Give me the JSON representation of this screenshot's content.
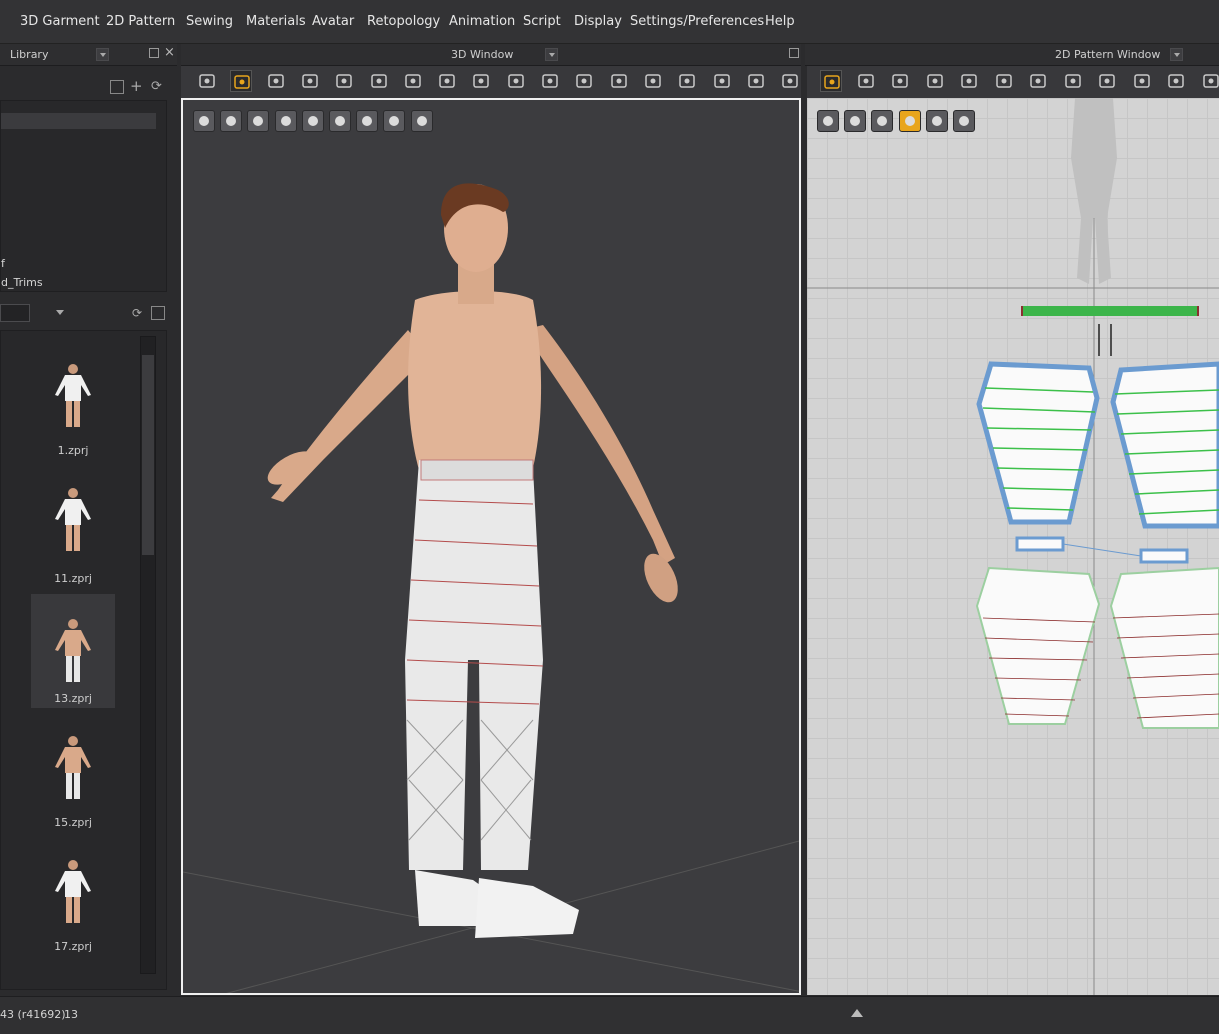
{
  "menu": [
    "3D Garment",
    "2D Pattern",
    "Sewing",
    "Materials",
    "Avatar",
    "Retopology",
    "Animation",
    "Script",
    "Display",
    "Settings/Preferences",
    "Help"
  ],
  "panels": {
    "library_title": "Library",
    "window3d_title": "3D Window",
    "pattern2d_title": "2D Pattern Window"
  },
  "library": {
    "tree_partial_1": "f",
    "tree_partial_2": "d_Trims",
    "items": [
      {
        "label": "1.zprj",
        "selected": false
      },
      {
        "label": "11.zprj",
        "selected": false
      },
      {
        "label": "13.zprj",
        "selected": true
      },
      {
        "label": "15.zprj",
        "selected": false
      },
      {
        "label": "17.zprj",
        "selected": false
      }
    ]
  },
  "status": {
    "version": "43 (r41692)",
    "count": "13"
  },
  "icons": {
    "toolbar3d": [
      "select-mesh-icon",
      "move-icon",
      "edit-pattern-icon",
      "fold-icon",
      "pin-icon",
      "segment-icon",
      "arrange-icon",
      "tuck-icon",
      "point-icon",
      "anchor-icon",
      "mesh-icon",
      "sewing-icon",
      "tape-icon",
      "button-icon",
      "zipper-icon",
      "cut-icon",
      "topstitch-icon",
      "bead-icon",
      "expand-icon"
    ],
    "viewport3d": [
      "show-garment-icon",
      "show-avatar-icon",
      "texture-icon",
      "avatar-icon",
      "thickness-icon",
      "stitch-icon",
      "skin-icon",
      "ball-icon",
      "export-icon"
    ],
    "toolbar2d": [
      "transform-pattern-icon",
      "edit-point-icon",
      "rectangle-icon",
      "internal-rect-icon",
      "pleat-icon",
      "rotate-icon",
      "grid-icon",
      "hide-icon",
      "sewing-icon",
      "segment-sew-icon",
      "stripes-icon",
      "line-icon"
    ],
    "viewport2d": [
      "pen-icon",
      "shirt-icon",
      "info-icon",
      "cube-icon",
      "garment-icon",
      "export-icon"
    ]
  },
  "colors": {
    "accent": "#e8a51c",
    "pattern_outline": "#5b8ec8",
    "pattern_stripe_green": "#3cc04a",
    "pattern_stripe_red": "#b23434",
    "selection_bar": "#3cb54a"
  }
}
